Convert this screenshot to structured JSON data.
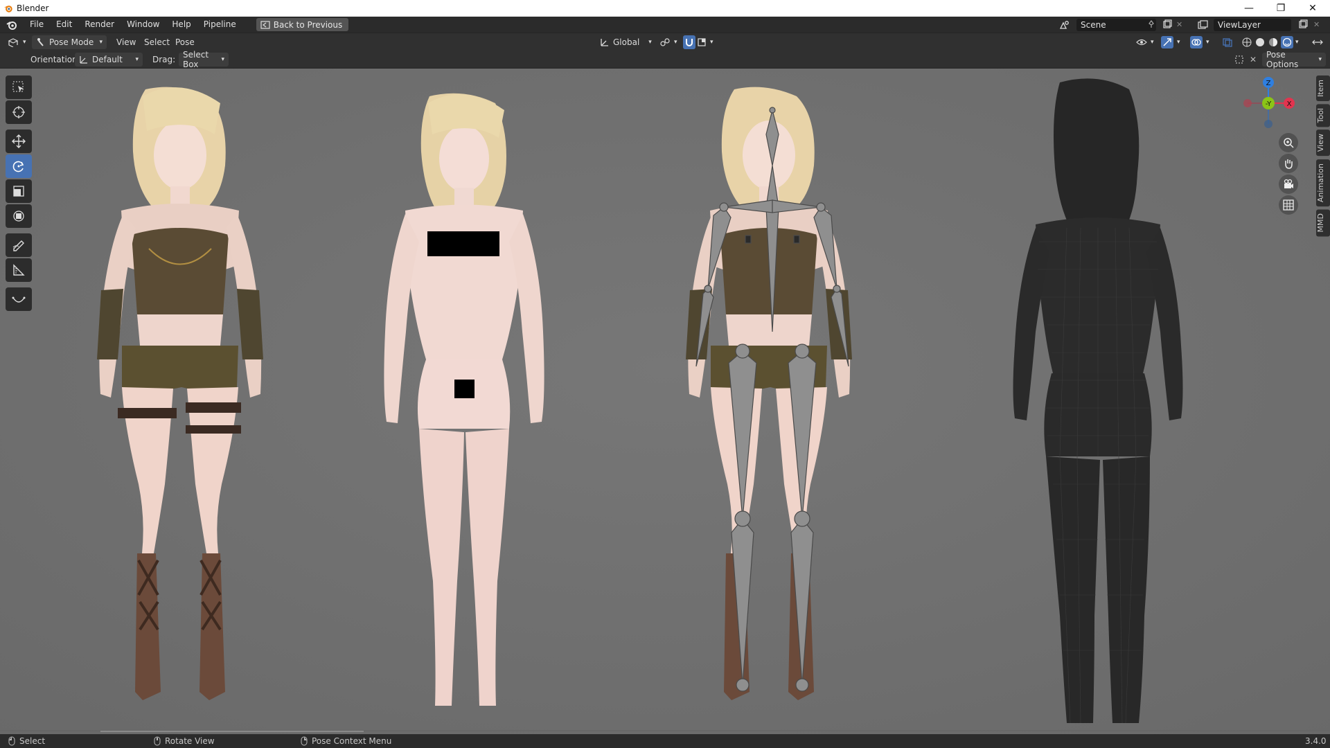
{
  "window": {
    "title": "Blender",
    "minimize_glyph": "—",
    "maximize_glyph": "❐",
    "close_glyph": "✕"
  },
  "menubar": {
    "items": [
      "File",
      "Edit",
      "Render",
      "Window",
      "Help",
      "Pipeline"
    ],
    "back_button": "Back to Previous",
    "scene": "Scene",
    "view_layer": "ViewLayer"
  },
  "header": {
    "mode": "Pose Mode",
    "menus": [
      "View",
      "Select",
      "Pose"
    ],
    "transform_orientation": "Global"
  },
  "tool_settings": {
    "orientation_label": "Orientation:",
    "orientation_value": "Default",
    "drag_label": "Drag:",
    "drag_value": "Select Box",
    "pose_options": "Pose Options"
  },
  "gizmo": {
    "z": "Z",
    "y": "-Y",
    "x": "X"
  },
  "sidebar_tabs": [
    "Item",
    "Tool",
    "View",
    "Animation",
    "MMD"
  ],
  "statusbar": {
    "select": "Select",
    "rotate": "Rotate View",
    "context": "Pose Context Menu",
    "version": "3.4.0"
  },
  "colors": {
    "accent": "#4772b3",
    "viewport_bg": "#6f6f6f",
    "gizmo_x": "#e2344f",
    "gizmo_y": "#8bc417",
    "gizmo_z": "#2f7fe0"
  }
}
